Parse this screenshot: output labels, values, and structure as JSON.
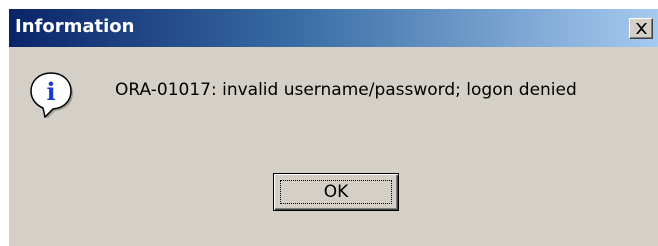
{
  "dialog": {
    "title": "Information",
    "close_icon": "close-x-icon",
    "icon": "information-icon",
    "icon_glyph": "i",
    "message": "ORA-01017: invalid username/password; logon denied",
    "ok_label": "OK"
  },
  "colors": {
    "titlebar_start": "#0a246a",
    "titlebar_end": "#a6caf0",
    "dialog_face": "#d4d0c8",
    "icon_blue": "#1a3ad0"
  }
}
